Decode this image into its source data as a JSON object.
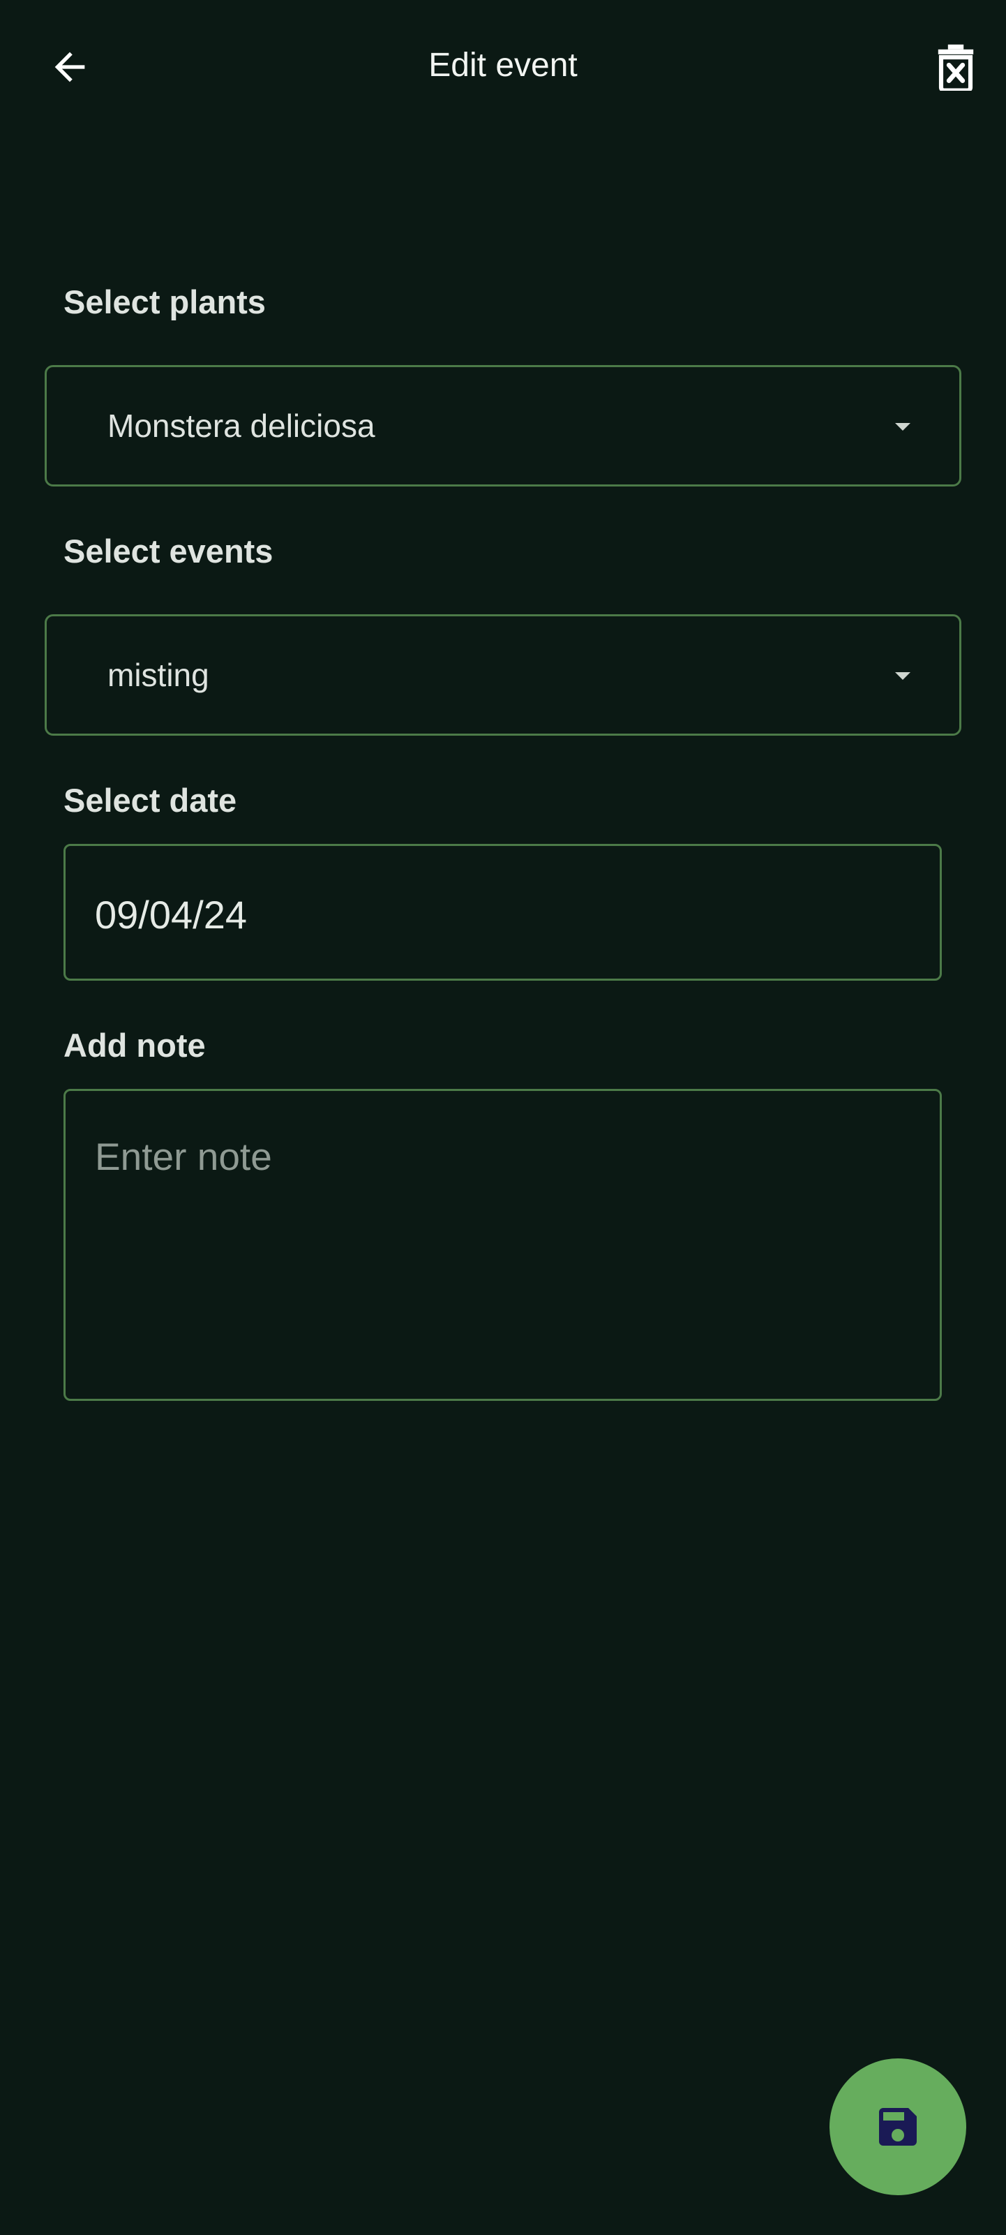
{
  "appbar": {
    "title": "Edit event",
    "back_icon": "arrow-left-icon",
    "delete_icon": "trash-x-icon"
  },
  "form": {
    "plants_label": "Select plants",
    "plants_value": "Monstera deliciosa",
    "events_label": "Select events",
    "events_value": "misting",
    "date_label": "Select date",
    "date_value": "09/04/24",
    "note_label": "Add note",
    "note_placeholder": "Enter note"
  },
  "fab": {
    "icon": "save-icon"
  },
  "colors": {
    "background": "#0b1914",
    "border": "#4c7a48",
    "fab": "#66ad5d",
    "fab_icon": "#1a1a55"
  }
}
